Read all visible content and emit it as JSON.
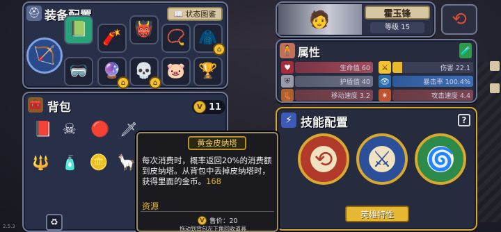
{
  "equipment": {
    "title": "装备配置",
    "status_button": "状态图鉴"
  },
  "hero": {
    "name": "霍玉锋",
    "level": "等级 15"
  },
  "attributes": {
    "title": "属性",
    "stats": [
      {
        "label": "生命值",
        "value": "60"
      },
      {
        "label": "伤害",
        "value": "22.1"
      },
      {
        "label": "护盾值",
        "value": "40"
      },
      {
        "label": "暴击率",
        "value": "100.4%"
      },
      {
        "label": "移动速度",
        "value": "3.2"
      },
      {
        "label": "攻击速度",
        "value": "4.4"
      }
    ]
  },
  "backpack": {
    "title": "背包",
    "gold": "11"
  },
  "skills": {
    "title": "技能配置",
    "help": "?",
    "hero_trait_button": "英雄特性"
  },
  "tooltip": {
    "item_name": "黄金皮纳塔",
    "desc_a": "每次消费时，概率返回20%的消费额到皮纳塔。从背包中丢掉皮纳塔时，获得里面的金币。",
    "desc_num": "168",
    "source_label": "资源",
    "price_label": "售价：20",
    "hint": "拖动到背包左下角回收道具"
  },
  "version": "2.5.3",
  "colors": {
    "panel": "#283049",
    "panel_border": "#6f7896",
    "gold": "#d9a82e",
    "highlight": "#e6b732"
  }
}
